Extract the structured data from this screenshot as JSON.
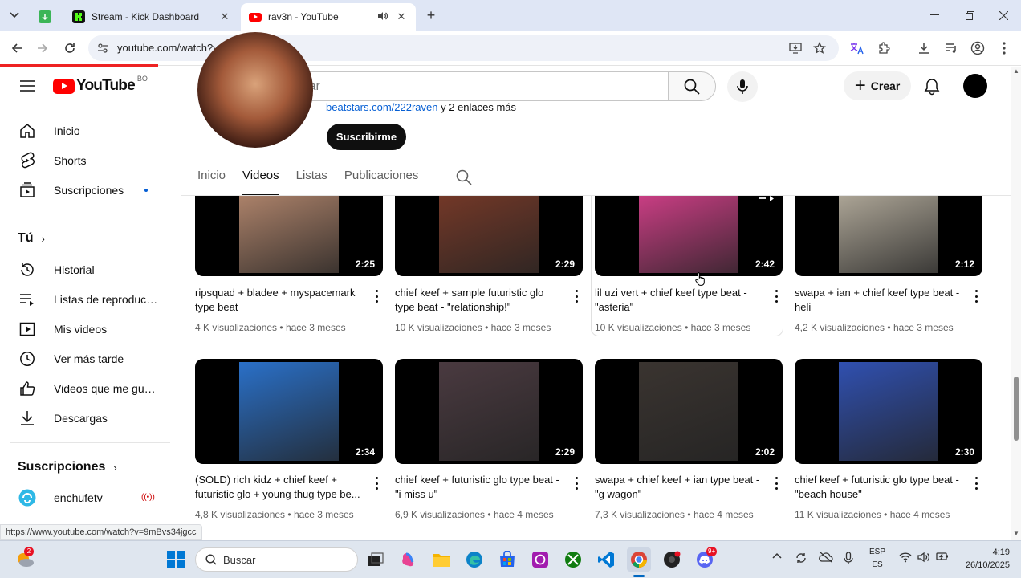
{
  "browser": {
    "tabs": [
      {
        "title": "Stream - Kick Dashboard"
      },
      {
        "title": "rav3n - YouTube"
      }
    ],
    "new_tab": "+",
    "url": "youtube.com/watch?v=9mBvs34jgcc",
    "status_url": "https://www.youtube.com/watch?v=9mBvs34jgcc"
  },
  "youtube": {
    "logo_text": "YouTube",
    "country_code": "BO",
    "search_placeholder": "Buscar",
    "create_label": "Crear"
  },
  "sidebar": {
    "main": [
      {
        "label": "Inicio",
        "icon": "home-icon"
      },
      {
        "label": "Shorts",
        "icon": "shorts-icon"
      },
      {
        "label": "Suscripciones",
        "icon": "subscriptions-icon"
      }
    ],
    "you_heading": "Tú",
    "you": [
      {
        "label": "Historial",
        "icon": "history-icon"
      },
      {
        "label": "Listas de reproducc...",
        "icon": "playlists-icon"
      },
      {
        "label": "Mis videos",
        "icon": "my-videos-icon"
      },
      {
        "label": "Ver más tarde",
        "icon": "watch-later-icon"
      },
      {
        "label": "Videos que me gus...",
        "icon": "liked-icon"
      },
      {
        "label": "Descargas",
        "icon": "downloads-icon"
      }
    ],
    "subs_heading": "Suscripciones",
    "subscriptions": [
      {
        "label": "enchufetv",
        "live": "((•))"
      }
    ]
  },
  "channel": {
    "links_text": "beatstars.com/222raven",
    "links_more": " y 2 enlaces más",
    "subscribe_label": "Suscribirme",
    "tabs": [
      "Inicio",
      "Videos",
      "Listas",
      "Publicaciones"
    ],
    "active_tab": "Videos"
  },
  "videos": [
    {
      "title": "ripsquad + bladee + myspacemark type beat",
      "duration": "2:25",
      "views": "4 K visualizaciones",
      "age": "hace 3 meses",
      "art": "#b88a70"
    },
    {
      "title": "chief keef + sample futuristic glo type beat - \"relationship!\"",
      "duration": "2:29",
      "views": "10 K visualizaciones",
      "age": "hace 3 meses",
      "art": "#7a3a28"
    },
    {
      "title": "lil uzi vert + chief keef type beat - \"asteria\"",
      "duration": "2:42",
      "views": "10 K visualizaciones",
      "age": "hace 3 meses",
      "art": "#d8408c"
    },
    {
      "title": "swapa + ian + chief keef type beat - heli",
      "duration": "2:12",
      "views": "4,2 K visualizaciones",
      "age": "hace 3 meses",
      "art": "#b8b0a0"
    },
    {
      "title": "(SOLD) rich kidz + chief keef + futuristic glo + young thug type be...",
      "duration": "2:34",
      "views": "4,8 K visualizaciones",
      "age": "hace 3 meses",
      "art": "#2a70c8"
    },
    {
      "title": "chief keef + futuristic glo type beat - \"i miss u\"",
      "duration": "2:29",
      "views": "6,9 K visualizaciones",
      "age": "hace 4 meses",
      "art": "#4a3a40"
    },
    {
      "title": "swapa + chief keef + ian type beat - \"g wagon\"",
      "duration": "2:02",
      "views": "7,3 K visualizaciones",
      "age": "hace 4 meses",
      "art": "#3a3430"
    },
    {
      "title": "chief keef + futuristic glo type beat - \"beach house\"",
      "duration": "2:30",
      "views": "11 K visualizaciones",
      "age": "hace 4 meses",
      "art": "#3050b0"
    }
  ],
  "taskbar": {
    "search_label": "Buscar",
    "notif_badge": "2",
    "discord_badge": "9+",
    "lang_top": "ESP",
    "lang_bottom": "ES",
    "time": "4:19",
    "date": "26/10/2025"
  }
}
